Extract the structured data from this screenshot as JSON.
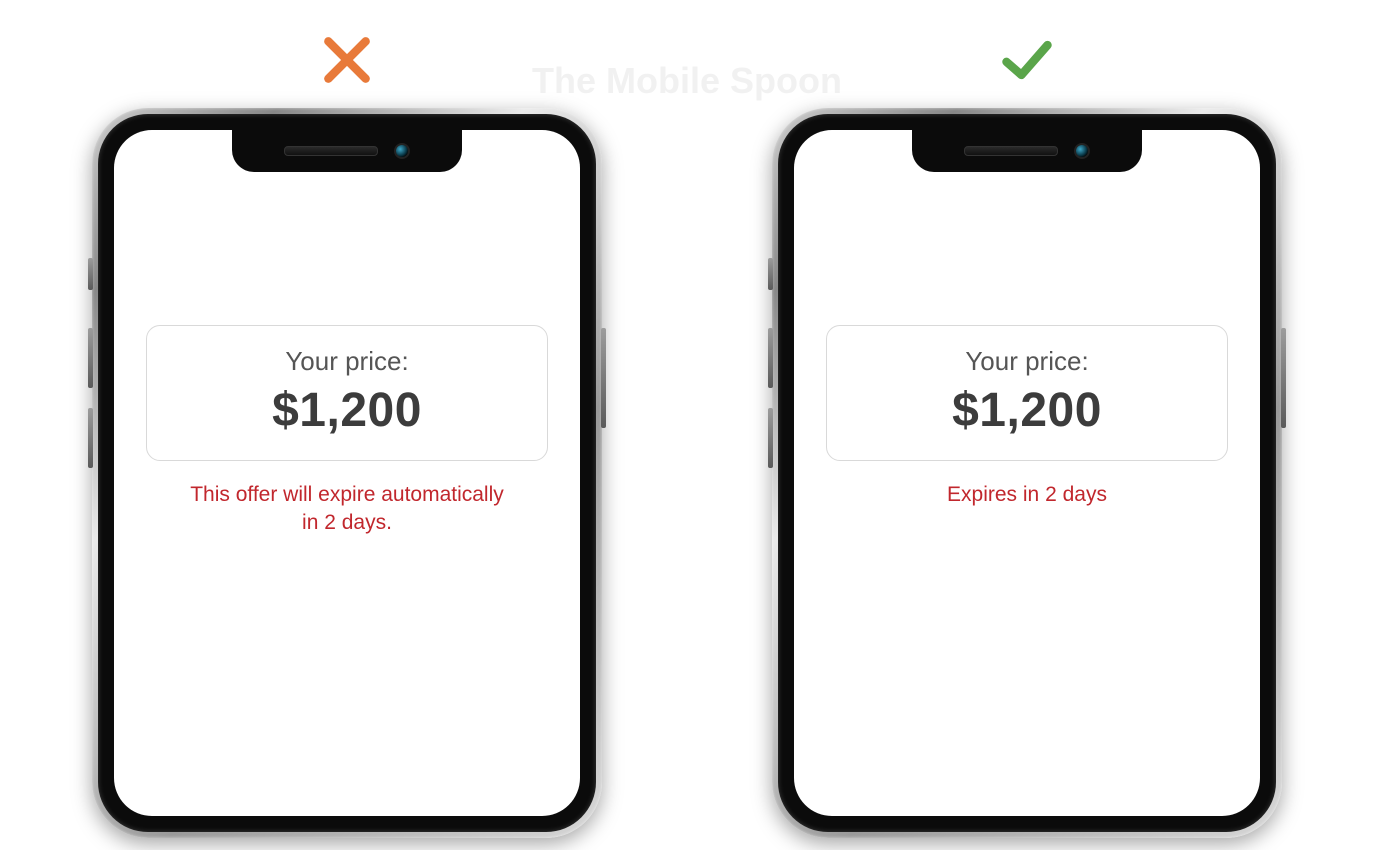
{
  "watermark": "The Mobile Spoon",
  "examples": {
    "bad": {
      "mark": "cross",
      "card": {
        "label": "Your price:",
        "price": "$1,200"
      },
      "expire_line1": "This offer will expire automatically",
      "expire_line2": "in 2 days."
    },
    "good": {
      "mark": "check",
      "card": {
        "label": "Your price:",
        "price": "$1,200"
      },
      "expire_line1": "Expires in 2 days",
      "expire_line2": ""
    }
  },
  "colors": {
    "bad": "#e87a3a",
    "good": "#5aa54a",
    "warn": "#c1272d"
  }
}
